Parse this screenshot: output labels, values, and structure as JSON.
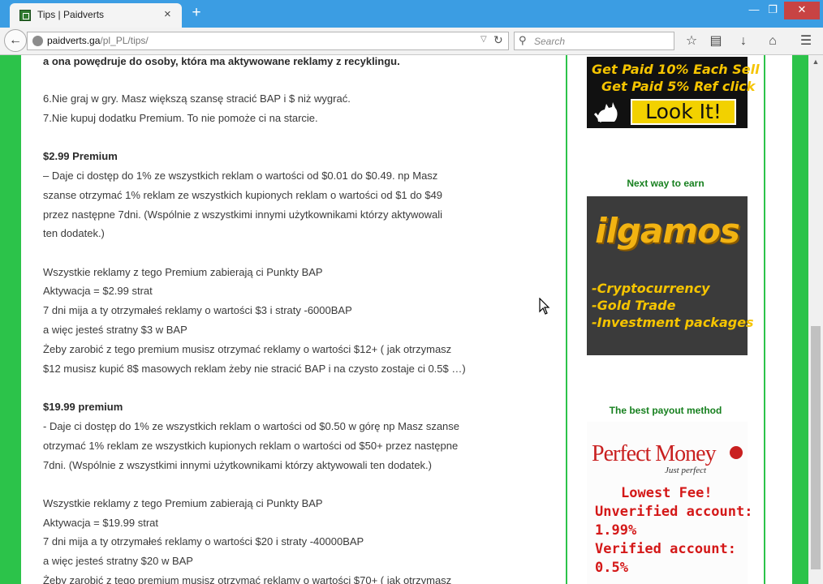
{
  "browser": {
    "tab_title": "Tips | Paidverts",
    "tab_close": "×",
    "new_tab": "+",
    "url_host": "paidverts.ga",
    "url_path": "/pl_PL/tips/",
    "search_placeholder": "Search",
    "window_controls": {
      "minimize": "—",
      "maximize": "❐",
      "close": "✕"
    },
    "icons": [
      "back-arrow-icon",
      "globe-icon",
      "reload-icon",
      "search-icon",
      "bookmark-star-icon",
      "reading-list-icon",
      "download-icon",
      "home-icon",
      "menu-icon"
    ]
  },
  "article": {
    "lines": [
      "a ona powędruje do osoby, która ma aktywowane reklamy z recyklingu.",
      "6.Nie graj w gry. Masz większą szansę stracić BAP i $ niż wygrać.",
      "7.Nie kupuj dodatku Premium. To nie pomoże ci na starcie.",
      "$2.99 Premium",
      "– Daje ci dostęp do 1% ze wszystkich reklam o wartości od $0.01 do $0.49. np Masz",
      "szanse otrzymać 1% reklam ze wszystkich kupionych reklam o wartości od $1 do $49",
      "przez następne 7dni.  (Wspólnie z wszystkimi innymi użytkownikami którzy aktywowali",
      "ten dodatek.)",
      "Wszystkie reklamy z tego Premium zabierają ci Punkty BAP",
      "Aktywacja = $2.99 strat",
      "7 dni mija a ty otrzymałeś reklamy o wartości $3 i straty -6000BAP",
      "a więc jesteś stratny $3 w BAP",
      "Żeby zarobić z tego premium musisz otrzymać reklamy o wartości $12+ ( jak otrzymasz",
      "$12 musisz kupić 8$ masowych reklam żeby nie stracić BAP i na czysto zostaje ci 0.5$ …)",
      "$19.99 premium",
      "- Daje ci dostęp do 1% ze wszystkich reklam o wartości od $0.50 w górę np Masz szanse",
      "otrzymać 1% reklam ze wszystkich kupionych reklam o wartości od $50+ przez następne",
      "7dni.  (Wspólnie z wszystkimi innymi użytkownikami którzy aktywowali ten dodatek.)",
      "Wszystkie reklamy z tego Premium zabierają ci Punkty BAP",
      "Aktywacja = $19.99 strat",
      "7 dni mija a ty otrzymałeś reklamy o wartości $20 i straty -40000BAP",
      "a więc jesteś stratny $20 w BAP",
      "Żeby zarobić z tego premium musisz otrzymać reklamy o wartości $70+ ( jak otrzymasz"
    ]
  },
  "sidebar": {
    "ad1": {
      "line1": "Get Paid 10% Each Sell",
      "line2": "Get Paid 5% Ref click",
      "button": "Look It!"
    },
    "title_next": "Next way to earn",
    "ad2": {
      "logo": "ilgamos",
      "items": [
        "-Cryptocurrency",
        "-Gold Trade",
        "-Investment packages"
      ]
    },
    "title_payout": "The best payout method",
    "ad3": {
      "brand": "Perfect Money",
      "tagline": "Just perfect",
      "lines": [
        "Lowest Fee!",
        "Unverified account:",
        "1.99%",
        "Verified account:",
        "0.5%"
      ]
    }
  },
  "colors": {
    "page_green": "#2cc34a",
    "titlebar_blue": "#3b9de3",
    "ad_yellow": "#f5c400",
    "pm_red": "#c92020",
    "sidebar_title_green": "#17801f"
  }
}
